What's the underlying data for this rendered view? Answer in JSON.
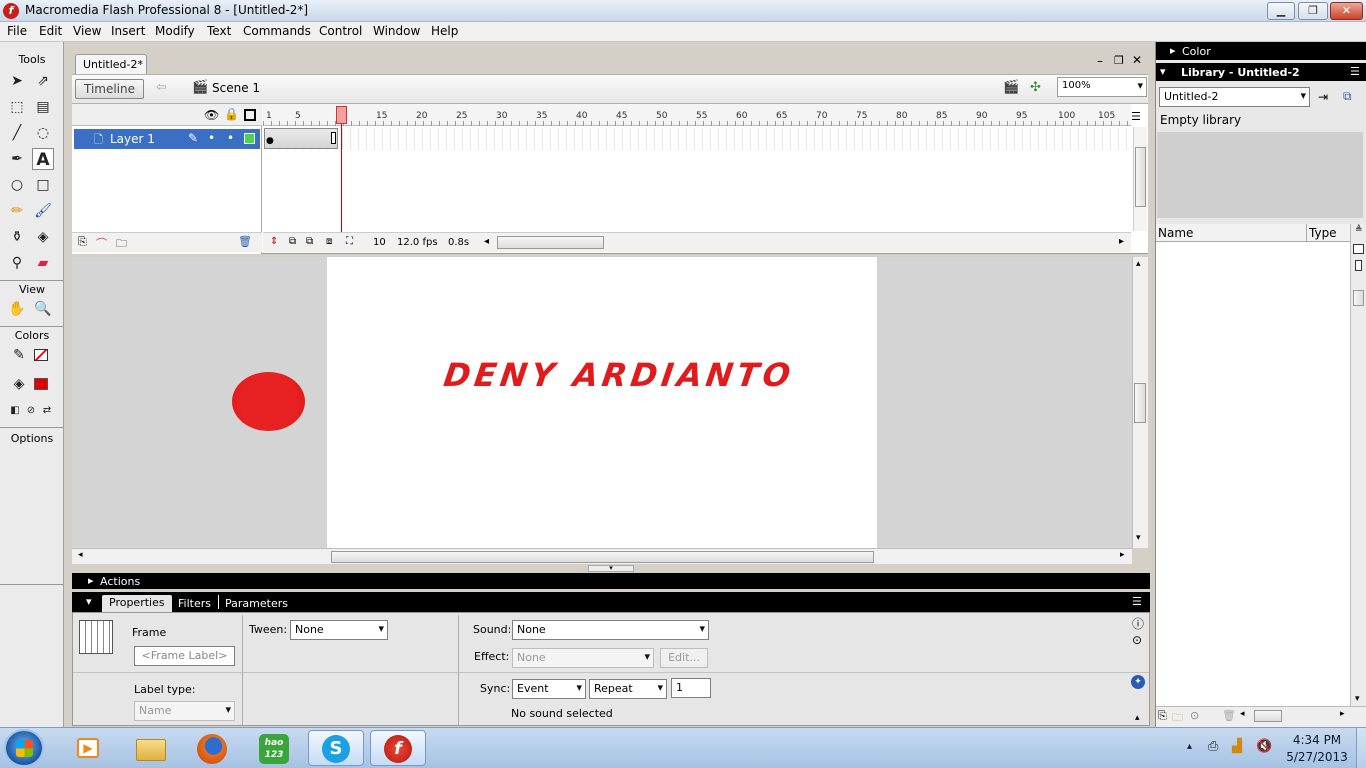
{
  "window": {
    "title": "Macromedia Flash Professional 8 - [Untitled-2*]",
    "app_icon": "flash-f-icon"
  },
  "menu": [
    "File",
    "Edit",
    "View",
    "Insert",
    "Modify",
    "Text",
    "Commands",
    "Control",
    "Window",
    "Help"
  ],
  "tools": {
    "title": "Tools",
    "view_label": "View",
    "colors_label": "Colors",
    "options_label": "Options",
    "stroke_color": "#000000",
    "fill_color": "#e00000"
  },
  "document": {
    "tab": "Untitled-2*",
    "timeline_button": "Timeline",
    "scene": "Scene 1",
    "zoom": "100%"
  },
  "timeline": {
    "ruler": [
      "1",
      "5",
      "10",
      "15",
      "20",
      "25",
      "30",
      "35",
      "40",
      "45",
      "50",
      "55",
      "60",
      "65",
      "70",
      "75",
      "80",
      "85",
      "90",
      "95",
      "100",
      "105"
    ],
    "layer": "Layer 1",
    "current_frame": "10",
    "fps": "12.0 fps",
    "time": "0.8s"
  },
  "stage": {
    "text": "DENY ARDIANTO",
    "text_color": "#e01b1b",
    "circle_color": "#e01b1b"
  },
  "panels": {
    "actions": "Actions",
    "tabs": [
      "Properties",
      "Filters",
      "Parameters"
    ]
  },
  "properties": {
    "frame_label": "Frame",
    "frame_label_placeholder": "<Frame Label>",
    "label_type_label": "Label type:",
    "label_type_value": "Name",
    "tween_label": "Tween:",
    "tween_value": "None",
    "sound_label": "Sound:",
    "sound_value": "None",
    "effect_label": "Effect:",
    "effect_value": "None",
    "edit_button": "Edit...",
    "sync_label": "Sync:",
    "sync_value": "Event",
    "repeat_value": "Repeat",
    "repeat_count": "1",
    "sound_status": "No sound selected"
  },
  "right_panel": {
    "color_title": "Color",
    "library_title": "Library - Untitled-2",
    "library_select": "Untitled-2",
    "empty_text": "Empty library",
    "col_name": "Name",
    "col_type": "Type"
  },
  "taskbar": {
    "time": "4:34 PM",
    "date": "5/27/2013",
    "apps": [
      "media-player-icon",
      "file-explorer-icon",
      "firefox-icon",
      "hao123-icon",
      "skype-icon",
      "flash-icon"
    ],
    "hao_label": "hao\n123"
  }
}
